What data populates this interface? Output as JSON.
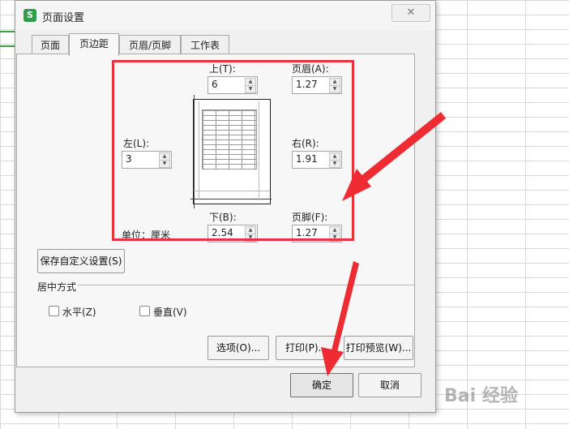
{
  "window": {
    "title": "页面设置",
    "close_glyph": "✕"
  },
  "tabs": [
    {
      "label": "页面",
      "active": false
    },
    {
      "label": "页边距",
      "active": true
    },
    {
      "label": "页眉/页脚",
      "active": false
    },
    {
      "label": "工作表",
      "active": false
    }
  ],
  "margins": {
    "top": {
      "label": "上(T):",
      "value": "6"
    },
    "header": {
      "label": "页眉(A):",
      "value": "1.27"
    },
    "left": {
      "label": "左(L):",
      "value": "3"
    },
    "right": {
      "label": "右(R):",
      "value": "1.91"
    },
    "bottom": {
      "label": "下(B):",
      "value": "2.54"
    },
    "footer": {
      "label": "页脚(F):",
      "value": "1.27"
    },
    "unit_label": "单位：厘米"
  },
  "save_custom_button": "保存自定义设置(S)",
  "center": {
    "group_label": "居中方式",
    "horizontal": {
      "label": "水平(Z)",
      "checked": false
    },
    "vertical": {
      "label": "垂直(V)",
      "checked": false
    }
  },
  "buttons": {
    "options": "选项(O)...",
    "print": "打印(P)...",
    "print_preview": "打印预览(W)...",
    "ok": "确定",
    "cancel": "取消"
  },
  "watermark": "Bai 经验",
  "colors": {
    "highlight": "#e8333c",
    "app_icon": "#2e9e4a"
  },
  "icons": [
    "app-icon",
    "close-icon",
    "spin-up-icon",
    "spin-down-icon",
    "checkbox-icon"
  ]
}
